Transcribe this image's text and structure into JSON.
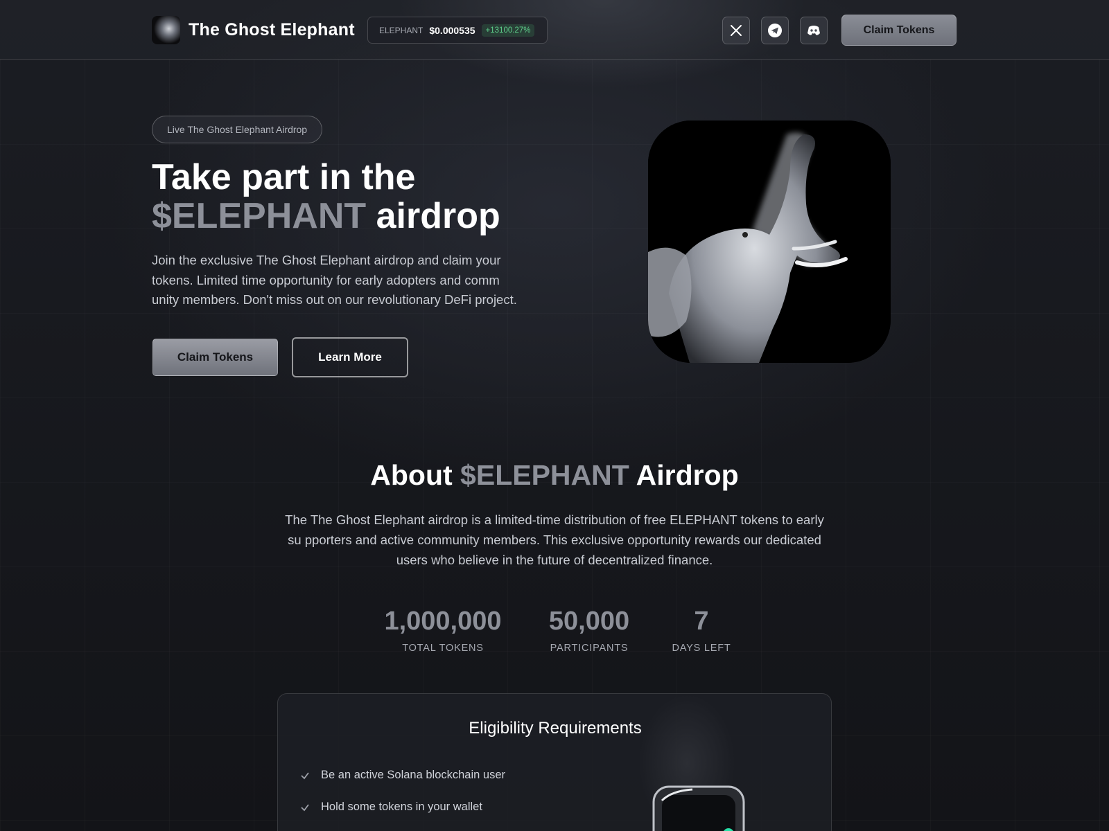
{
  "nav": {
    "brand": "The Ghost Elephant",
    "ticker": {
      "symbol": "ELEPHANT",
      "price": "$0.000535",
      "change": "+13100.27%"
    },
    "social_icons": [
      "x-icon",
      "telegram-icon",
      "discord-icon"
    ],
    "claim_label": "Claim Tokens"
  },
  "hero": {
    "badge": "Live The Ghost Elephant Airdrop",
    "title_line1": "Take part in the",
    "title_token": "$ELEPHANT",
    "title_rest": " airdrop",
    "description": "Join the exclusive The Ghost Elephant airdrop and claim your tokens. Limited time opportunity for early adopters and comm unity members. Don't miss out on our revolutionary DeFi project.",
    "claim_label": "Claim Tokens",
    "learn_label": "Learn More"
  },
  "about": {
    "title_prefix": "About ",
    "title_token": "$ELEPHANT",
    "title_suffix": " Airdrop",
    "description": "The The Ghost Elephant airdrop is a limited-time distribution of free ELEPHANT tokens to early su pporters and active community members. This exclusive opportunity rewards our dedicated users who believe in the future of decentralized finance.",
    "stats": [
      {
        "value": "1,000,000",
        "label": "TOTAL TOKENS"
      },
      {
        "value": "50,000",
        "label": "PARTICIPANTS"
      },
      {
        "value": "7",
        "label": "DAYS LEFT"
      }
    ]
  },
  "eligibility": {
    "title": "Eligibility Requirements",
    "items": [
      "Be an active Solana blockchain user",
      "Hold some tokens in your wallet"
    ]
  },
  "colors": {
    "accent_muted": "#8d9099",
    "positive": "#5fd08c",
    "background": "#15171c"
  }
}
